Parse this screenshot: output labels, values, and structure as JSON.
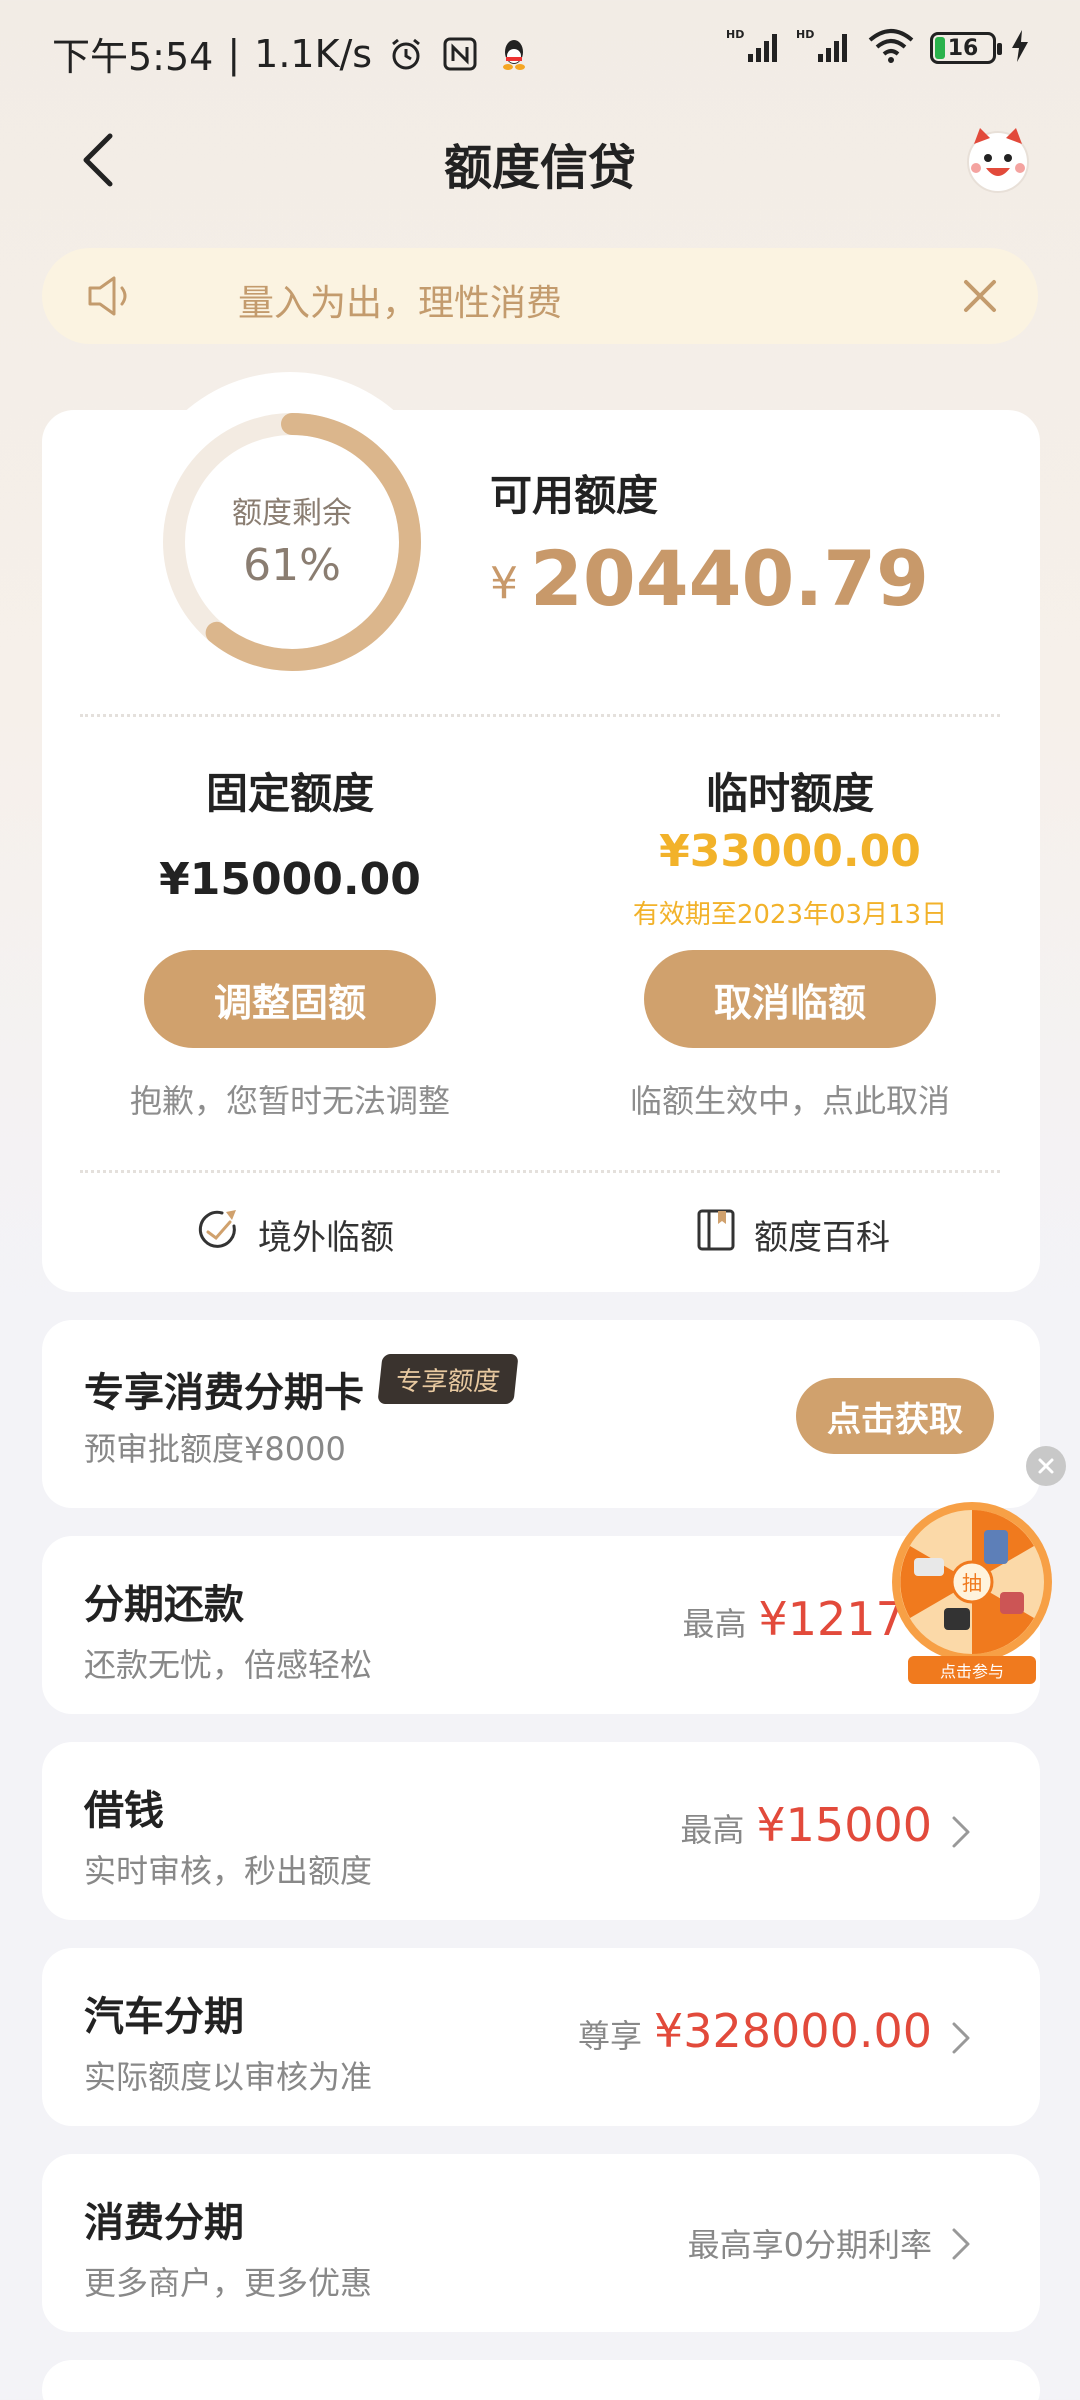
{
  "status_bar": {
    "time": "下午5:54",
    "speed": "1.1K/s",
    "battery": "16",
    "icons": [
      "alarm-icon",
      "nfc-icon",
      "qq-icon",
      "signal-hd-icon",
      "signal-hd-icon",
      "wifi-icon",
      "battery-icon",
      "charging-icon"
    ]
  },
  "header": {
    "title": "额度信贷",
    "icons": [
      "back-arrow-icon",
      "mascot-icon"
    ]
  },
  "notice": {
    "text": "量入为出，理性消费",
    "icons": [
      "speaker-icon",
      "close-icon"
    ]
  },
  "credit": {
    "ring_label": "额度剩余",
    "ring_percent": "61%",
    "ring_fraction": 0.61,
    "available_label": "可用额度",
    "currency": "¥",
    "available_amount": "20440.79",
    "fixed": {
      "title": "固定额度",
      "amount": "¥15000.00",
      "button": "调整固额",
      "note": "抱歉，您暂时无法调整"
    },
    "temporary": {
      "title": "临时额度",
      "amount": "¥33000.00",
      "valid_until": "有效期至2023年03月13日",
      "button": "取消临额",
      "note": "临额生效中，点此取消"
    },
    "links": [
      {
        "label": "境外临额",
        "icon": "plane-globe-icon"
      },
      {
        "label": "额度百科",
        "icon": "book-icon"
      }
    ]
  },
  "colors": {
    "gold": "#c8996a",
    "button_gold": "#d0a16d",
    "highlight_yellow": "#f2b22a",
    "red": "#e24a3b"
  },
  "cards": {
    "installment_card": {
      "title": "专享消费分期卡",
      "badge": "专享额度",
      "subtitle": "预审批额度¥8000",
      "button": "点击获取"
    },
    "items": [
      {
        "title": "分期还款",
        "subtitle": "还款无忧，倍感轻松",
        "prefix": "最高",
        "value": "¥12176.0"
      },
      {
        "title": "借钱",
        "subtitle": "实时审核，秒出额度",
        "prefix": "最高",
        "value": "¥15000"
      },
      {
        "title": "汽车分期",
        "subtitle": "实际额度以审核为准",
        "prefix": "尊享",
        "value": "¥328000.00"
      },
      {
        "title": "消费分期",
        "subtitle": "更多商户，更多优惠",
        "text": "最高享0分期利率"
      }
    ]
  },
  "floating": {
    "wheel_center": "抽",
    "wheel_caption": "点击参与",
    "icons": [
      "close-icon",
      "prize-wheel-icon"
    ]
  }
}
